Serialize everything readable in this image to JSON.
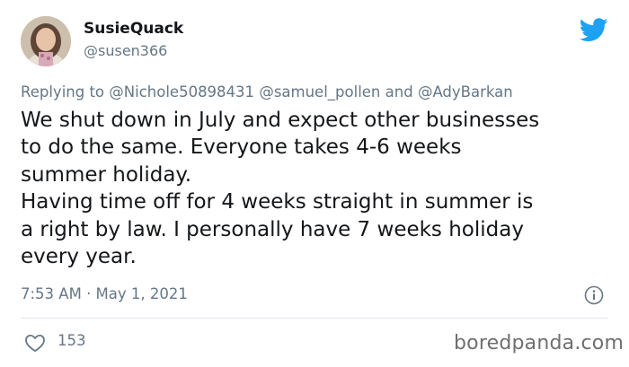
{
  "author": {
    "display_name": "SusieQuack",
    "handle": "@susen366"
  },
  "reply": {
    "prefix": "Replying to",
    "mentions": [
      "@Nichole50898431",
      "@samuel_pollen"
    ],
    "and": "and",
    "last_mention": "@AdyBarkan"
  },
  "tweet": {
    "lines": [
      "We shut down in July and expect other businesses",
      "to do the same. Everyone takes 4-6 weeks",
      "summer holiday.",
      "Having time off for 4 weeks straight in summer is",
      "a right by law. I personally have 7 weeks holiday",
      "every year."
    ],
    "timestamp": "7:53 AM · May 1, 2021"
  },
  "engagement": {
    "likes": "153"
  },
  "watermark": "boredpanda.com",
  "icons": {
    "brand": "twitter-bird-icon",
    "info": "info-icon",
    "like": "heart-icon"
  },
  "colors": {
    "twitter_blue": "#1da1f2",
    "secondary_text": "#657786",
    "primary_text": "#14171a"
  }
}
